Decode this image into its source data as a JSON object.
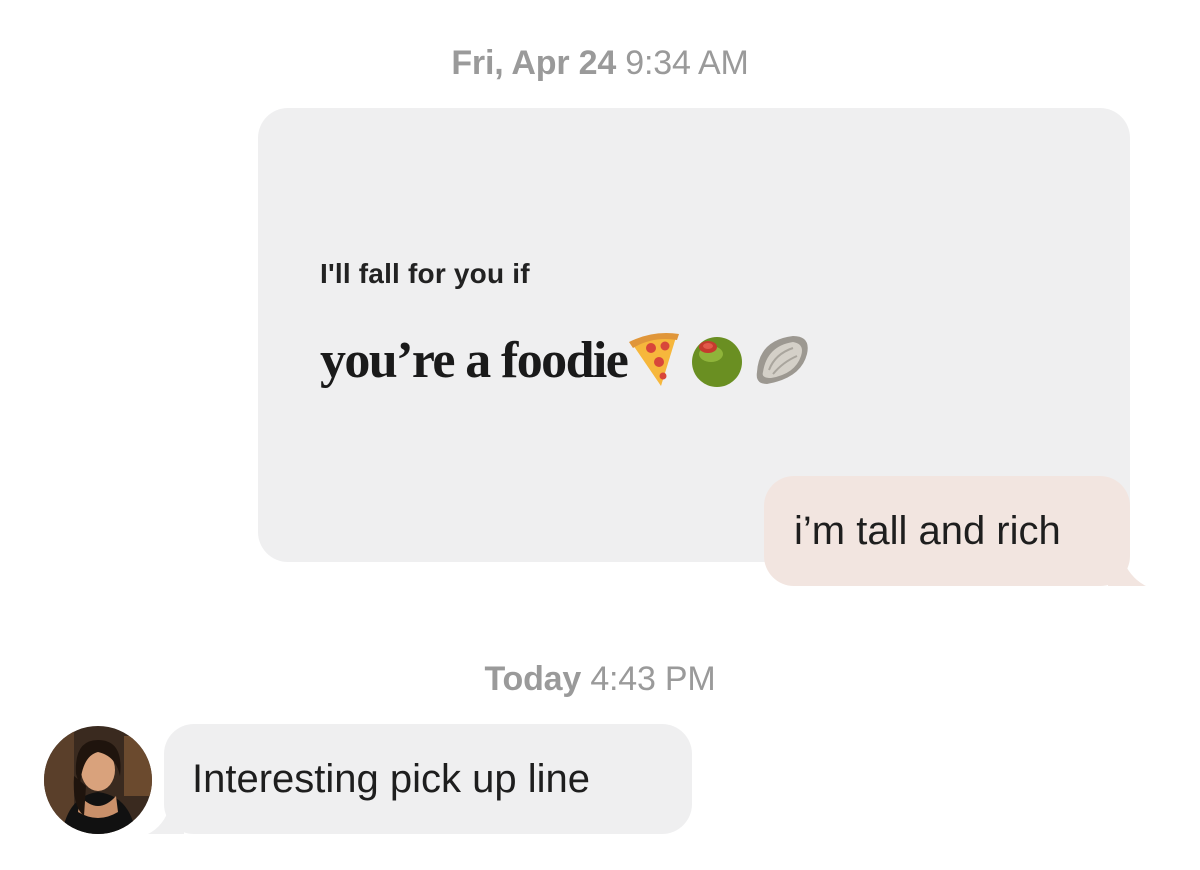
{
  "conversation": {
    "timestamp_1": {
      "day": "Fri, Apr 24",
      "time": "9:34 AM"
    },
    "prompt": {
      "question": "I'll fall for you if",
      "answer": "you’re a foodie",
      "emojis": [
        "pizza-icon",
        "olive-icon",
        "oyster-icon"
      ]
    },
    "reply": {
      "text": "i’m tall and rich"
    },
    "timestamp_2": {
      "day": "Today",
      "time": "4:43 PM"
    },
    "incoming": {
      "text": "Interesting pick up line",
      "avatar": "avatar"
    }
  },
  "colors": {
    "background": "#ffffff",
    "prompt_card": "#efeff0",
    "outgoing_bubble": "#f2e5e0",
    "incoming_bubble": "#efeff0",
    "timestamp": "#9a9a9a"
  }
}
